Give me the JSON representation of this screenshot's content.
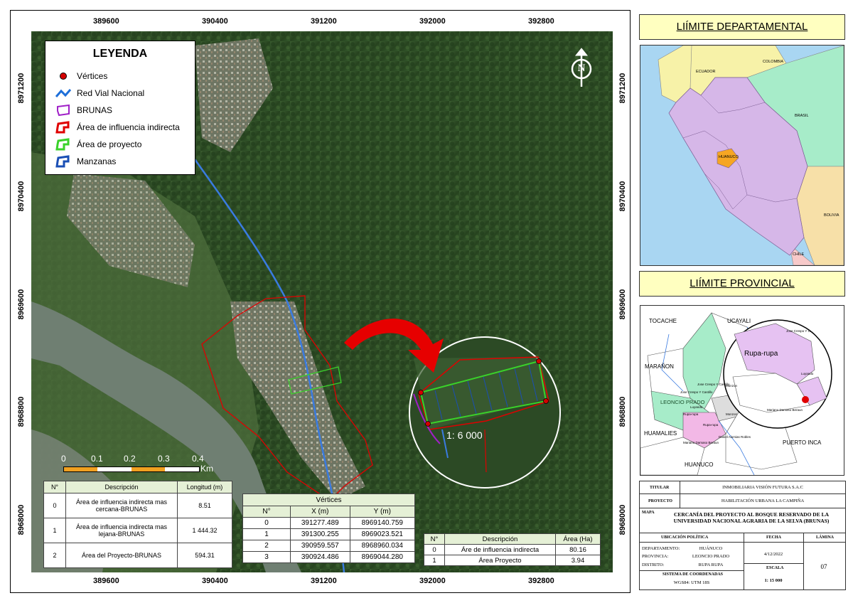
{
  "coords": {
    "top_x": [
      "389600",
      "390400",
      "391200",
      "392000",
      "392800"
    ],
    "bottom_x": [
      "389600",
      "390400",
      "391200",
      "392000",
      "392800"
    ],
    "left_y": [
      "8971200",
      "8970400",
      "8969600",
      "8968800",
      "8968000"
    ],
    "right_y": [
      "8971200",
      "8970400",
      "8969600",
      "8968800",
      "8968000"
    ]
  },
  "legend": {
    "title": "LEYENDA",
    "items": [
      {
        "label": "Vértices",
        "color": "#d40000",
        "icon": "vertex-point"
      },
      {
        "label": "Red Vial Nacional",
        "color": "#1e6fd9",
        "icon": "road-line"
      },
      {
        "label": "BRUNAS",
        "color": "#a020c8",
        "icon": "polygon-outline"
      },
      {
        "label": "Área de influencia indirecta",
        "color": "#e00000",
        "icon": "polygon-outline"
      },
      {
        "label": "Área de proyecto",
        "color": "#3ad22a",
        "icon": "polygon-outline"
      },
      {
        "label": "Manzanas",
        "color": "#1a4fb5",
        "icon": "polygon-outline"
      }
    ]
  },
  "north_arrow": "N",
  "zoom_scale": "1: 6 000",
  "scale_bar": {
    "ticks": [
      "0",
      "0.1",
      "0.2",
      "0.3",
      "0.4"
    ],
    "unit": "Km"
  },
  "table_areas": {
    "headers": [
      "N°",
      "Descripción",
      "Longitud (m)"
    ],
    "rows": [
      [
        "0",
        "Área de influencia indirecta mas cercana-BRUNAS",
        "8.51"
      ],
      [
        "1",
        "Área de influencia indirecta mas lejana-BRUNAS",
        "1 444.32"
      ],
      [
        "2",
        "Área del Proyecto-BRUNAS",
        "594.31"
      ]
    ]
  },
  "table_vertices": {
    "title": "Vértices",
    "headers": [
      "N°",
      "X (m)",
      "Y (m)"
    ],
    "rows": [
      [
        "0",
        "391277.489",
        "8969140.759"
      ],
      [
        "1",
        "391300.255",
        "8969023.521"
      ],
      [
        "2",
        "390959.557",
        "8968960.034"
      ],
      [
        "3",
        "390924.486",
        "8969044.280"
      ]
    ]
  },
  "table_hectares": {
    "headers": [
      "N°",
      "Descripción",
      "Área (Ha)"
    ],
    "rows": [
      [
        "0",
        "Áre de influencia indirecta",
        "80.16"
      ],
      [
        "1",
        "Área Proyecto",
        "3.94"
      ]
    ]
  },
  "dept": {
    "title": "LIÍMITE DEPARTAMENTAL",
    "labels": [
      "ECUADOR",
      "COLOMBIA",
      "BRASIL",
      "HUANUCO",
      "BOLIVIA",
      "CHILE"
    ]
  },
  "prov": {
    "title": "LIÍMITE PROVINCIAL",
    "labels": [
      "TOCACHE",
      "UCAYALI",
      "MARAÑON",
      "LEONCIO PRADO",
      "HUAMALIES",
      "PUERTO INCA",
      "HUANUCO",
      "Rupa-rupa",
      "Jose Crespo Y Castillo",
      "Monzon",
      "Daniel Alomias Robles",
      "Mariano Damaso Beraun",
      "Luyando",
      "Rupa-rupa",
      "Jose Crespo Y C...",
      "Luyando",
      "Mariano Damaso Beraun",
      "Monzon",
      "Rupa-rupa",
      "Jose Crespo Y Castillo"
    ]
  },
  "titleblock": {
    "titular_lbl": "TITULAR",
    "titular": "INMOBILIARIA VISIÓN FUTURA S.A.C",
    "proyecto_lbl": "PROYECTO",
    "proyecto": "HABILITACIÓN URBANA LA CAMPIÑA",
    "mapa_lbl": "MAPA",
    "mapa": "CERCANÍA DEL PROYECTO  AL BOSQUE RESERVADO DE LA UNIVERSIDAD NACIONAL AGRARIA DE LA SELVA (BRUNAS)",
    "ubic_lbl": "UBICACIÓN POLÍTICA",
    "fecha_lbl": "FECHA",
    "lamina_lbl": "LÁMINA",
    "dep_lbl": "DEPARTAMENTO:",
    "dep": "HUÁNUCO",
    "prov_lbl": "PROVINCIA:",
    "prov": "LEONCIO PRADO",
    "dist_lbl": "DISTRITO:",
    "dist": "RUPA RUPA",
    "fecha": "4/12/2022",
    "lamina": "07",
    "escala_lbl": "ESCALA",
    "escala": "1: 15 000",
    "sis_lbl": "SISTEMA DE COORDENADAS",
    "sis": "WGS84: UTM 18S"
  }
}
